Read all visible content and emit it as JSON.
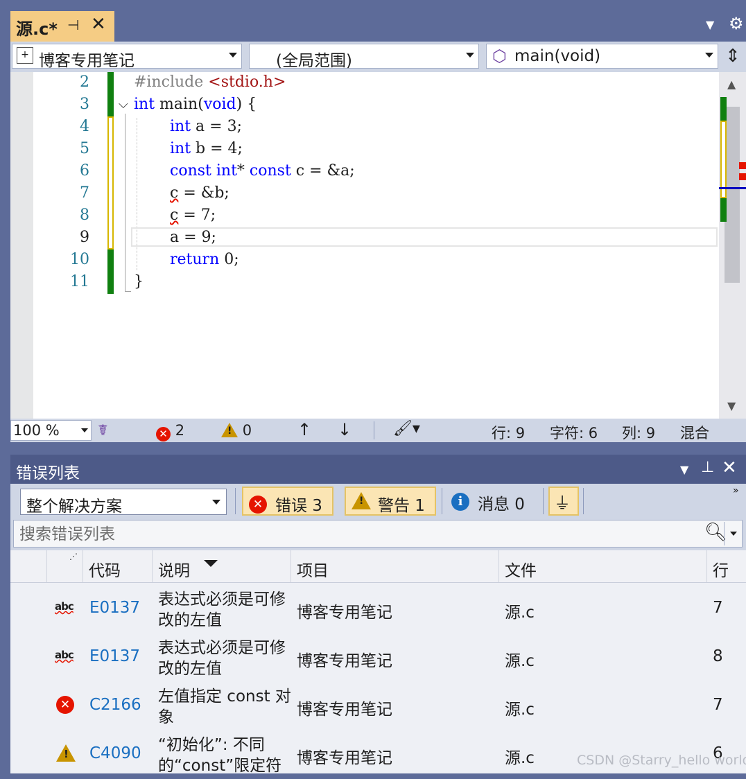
{
  "doc_tab": {
    "title": "源.c*",
    "pin_icon": "pin-icon",
    "close_icon": "close-icon"
  },
  "nav": {
    "project": "博客专用笔记",
    "scope": "(全局范围)",
    "member": "main(void)"
  },
  "editor": {
    "line_numbers": [
      "2",
      "3",
      "4",
      "5",
      "6",
      "7",
      "8",
      "9",
      "10",
      "11"
    ],
    "current_line": "9",
    "lines": [
      [
        "#include ",
        "<stdio.h>"
      ],
      [
        "int",
        " main(",
        "void",
        ") {"
      ],
      [
        "int",
        " a = 3;"
      ],
      [
        "int",
        " b = 4;"
      ],
      [
        "const",
        " ",
        "int",
        "* ",
        "const",
        " c = &a;"
      ],
      [
        "c",
        " = &b;"
      ],
      [
        "c",
        " = 7;"
      ],
      [
        "a = 9;"
      ],
      [
        "return",
        " 0;"
      ],
      [
        "}"
      ]
    ]
  },
  "status": {
    "zoom": "100 %",
    "errors": "2",
    "warnings": "0",
    "row": "行: 9",
    "char": "字符: 6",
    "col": "列: 9",
    "mode": "混合"
  },
  "error_list": {
    "title": "错误列表",
    "scope": "整个解决方案",
    "errors_btn": "错误 3",
    "warnings_btn": "警告 1",
    "messages_btn": "消息 0",
    "search_placeholder": "搜索错误列表",
    "columns": [
      "代码",
      "说明",
      "项目",
      "文件",
      "行"
    ],
    "rows": [
      {
        "icon": "spell-abc-icon",
        "code": "E0137",
        "desc": "表达式必须是可修改的左值",
        "project": "博客专用笔记",
        "file": "源.c",
        "line": "7"
      },
      {
        "icon": "spell-abc-icon",
        "code": "E0137",
        "desc": "表达式必须是可修改的左值",
        "project": "博客专用笔记",
        "file": "源.c",
        "line": "8"
      },
      {
        "icon": "error-icon",
        "code": "C2166",
        "desc": "左值指定 const 对象",
        "project": "博客专用笔记",
        "file": "源.c",
        "line": "7"
      },
      {
        "icon": "warning-icon",
        "code": "C4090",
        "desc": "“初始化”: 不同的“const”限定符",
        "project": "博客专用笔记",
        "file": "源.c",
        "line": "6"
      }
    ]
  },
  "watermark": "CSDN @Starry_hello world",
  "colors": {
    "keyword": "#0000ff",
    "error": "#e51400",
    "warning": "#c89400",
    "tab_active": "#f5cc84",
    "link": "#1a6fc1"
  }
}
